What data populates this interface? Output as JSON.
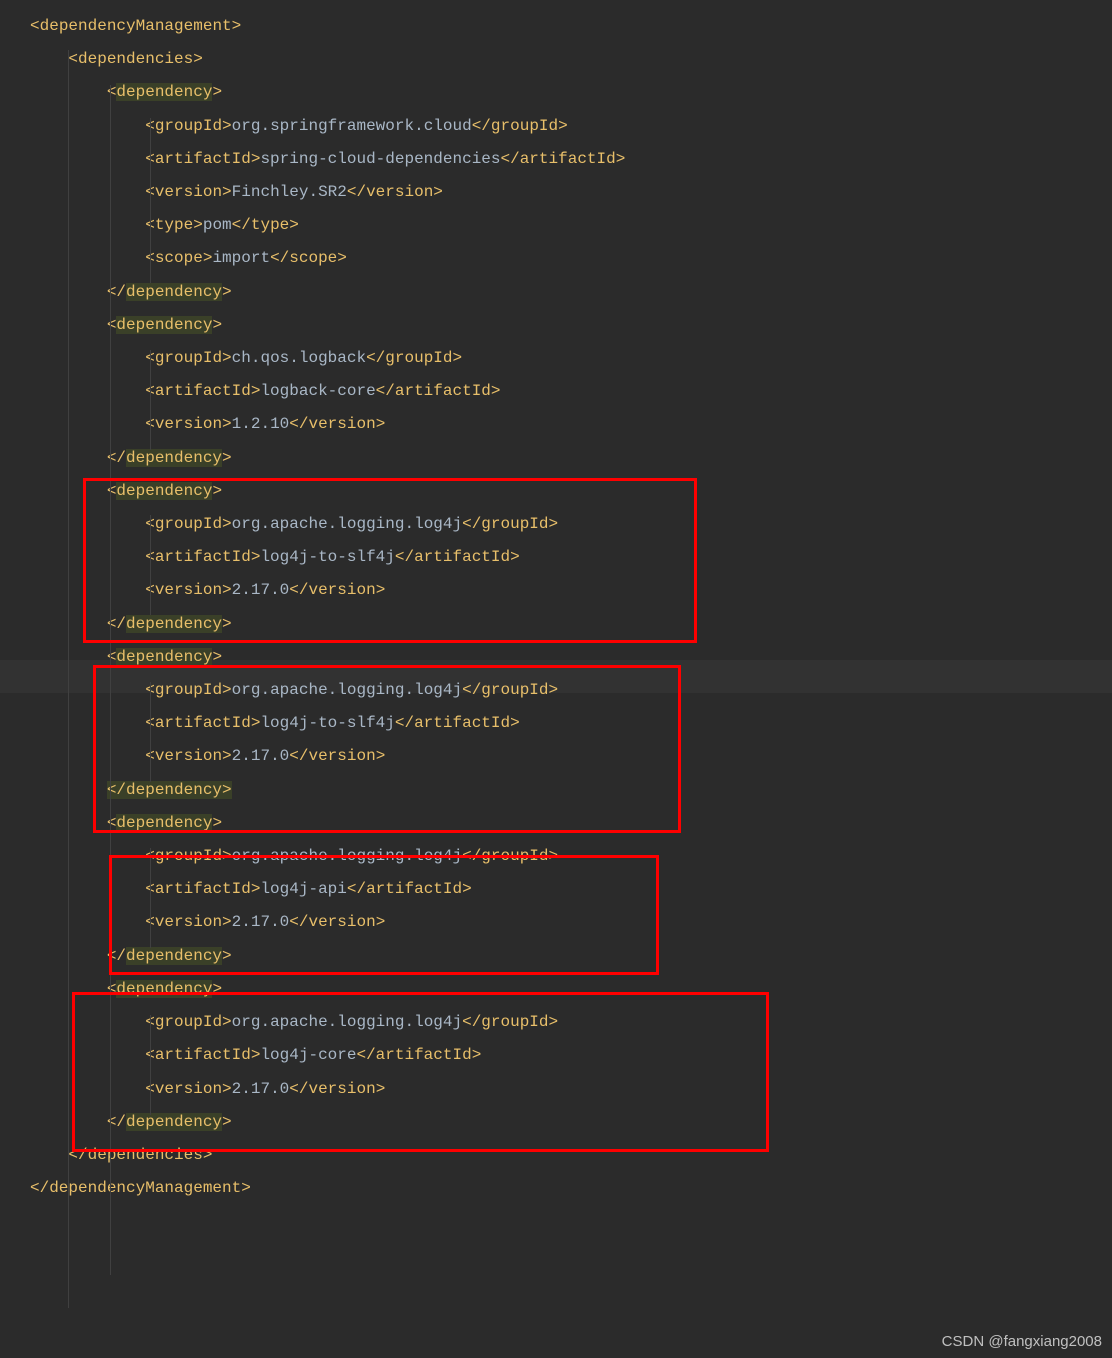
{
  "tags": {
    "depMgmt": "dependencyManagement",
    "deps": "dependencies",
    "dep": "dependency",
    "gid": "groupId",
    "aid": "artifactId",
    "ver": "version",
    "type": "type",
    "scope": "scope"
  },
  "dependencies": [
    {
      "groupId": "org.springframework.cloud",
      "artifactId": "spring-cloud-dependencies",
      "version": "Finchley.SR2",
      "type": "pom",
      "scope": "import"
    },
    {
      "groupId": "ch.qos.logback",
      "artifactId": "logback-core",
      "version": "1.2.10"
    },
    {
      "groupId": "org.apache.logging.log4j",
      "artifactId": "log4j-to-slf4j",
      "version": "2.17.0"
    },
    {
      "groupId": "org.apache.logging.log4j",
      "artifactId": "log4j-to-slf4j",
      "version": "2.17.0"
    },
    {
      "groupId": "org.apache.logging.log4j",
      "artifactId": "log4j-api",
      "version": "2.17.0"
    },
    {
      "groupId": "org.apache.logging.log4j",
      "artifactId": "log4j-core",
      "version": "2.17.0"
    }
  ],
  "watermark": "CSDN @fangxiang2008"
}
